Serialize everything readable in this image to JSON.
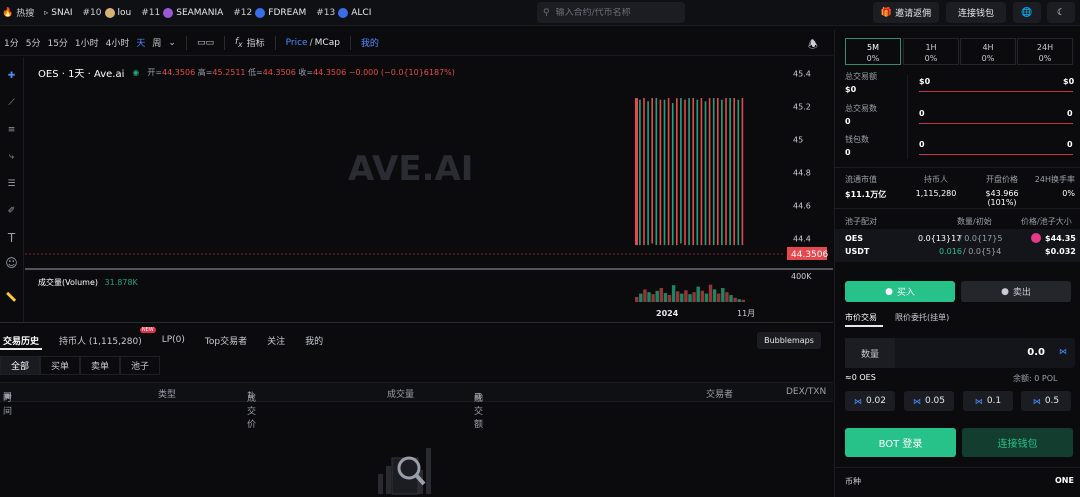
{
  "topbar": {
    "hot_label": "热搜",
    "items": [
      {
        "rank": "",
        "name": "SNAI",
        "color": "#e6e8ec"
      },
      {
        "rank": "#10",
        "name": "lou",
        "color": "#d8b273"
      },
      {
        "rank": "#11",
        "name": "SEAMANIA",
        "color": "#9b59d6"
      },
      {
        "rank": "#12",
        "name": "FDREAM",
        "color": "#3a6ee8"
      },
      {
        "rank": "#13",
        "name": "ALCI",
        "color": "#3a6ee8"
      }
    ],
    "search_placeholder": "输入合约/代币名称",
    "invite_label": "邀请返佣",
    "connect_wallet": "连接钱包",
    "icons": [
      "fire-icon",
      "search-icon",
      "gift-icon",
      "globe-icon",
      "moon-icon"
    ]
  },
  "chart_toolbar": {
    "timeframes": [
      "1分",
      "5分",
      "15分",
      "1小时",
      "4小时",
      "天",
      "周"
    ],
    "active_timeframe": "天",
    "indicator_label": "指标",
    "price_label": "Price",
    "mcap_label": "MCap",
    "mine_label": "我的"
  },
  "chart_data": {
    "type": "candlestick",
    "title": "OES · 1天 · Ave.ai",
    "ohlc_text": {
      "open_label": "开=",
      "open": "44.3506",
      "high_label": "高=",
      "high": "45.2511",
      "low_label": "低=",
      "low": "44.3506",
      "close_label": "收=",
      "close": "44.3506",
      "change": "−0.000 (−0.0{10}6187%)"
    },
    "watermark": "AVE.AI",
    "y_ticks": [
      "45.4",
      "45.2",
      "45",
      "44.8",
      "44.6",
      "44.4"
    ],
    "ylim": [
      44.3,
      45.45
    ],
    "current_price": "44.3506",
    "volume_label": "成交量(Volume)",
    "volume_value": "31.878K",
    "volume_tick": "400K",
    "x_ticks": [
      "2024",
      "11月"
    ],
    "candles": [
      {
        "o": 45.25,
        "c": 44.36,
        "dir": "down"
      },
      {
        "o": 44.36,
        "c": 45.24,
        "dir": "up"
      },
      {
        "o": 45.25,
        "c": 44.36,
        "dir": "down"
      },
      {
        "o": 44.36,
        "c": 45.23,
        "dir": "up"
      },
      {
        "o": 45.25,
        "c": 44.37,
        "dir": "down"
      },
      {
        "o": 44.36,
        "c": 45.25,
        "dir": "up"
      },
      {
        "o": 45.24,
        "c": 44.36,
        "dir": "down"
      },
      {
        "o": 44.36,
        "c": 45.24,
        "dir": "up"
      },
      {
        "o": 45.25,
        "c": 44.36,
        "dir": "down"
      },
      {
        "o": 44.36,
        "c": 45.22,
        "dir": "up"
      },
      {
        "o": 45.25,
        "c": 44.36,
        "dir": "down"
      },
      {
        "o": 44.37,
        "c": 45.25,
        "dir": "up"
      },
      {
        "o": 45.24,
        "c": 44.36,
        "dir": "down"
      },
      {
        "o": 44.36,
        "c": 45.25,
        "dir": "up"
      },
      {
        "o": 45.25,
        "c": 44.36,
        "dir": "down"
      },
      {
        "o": 44.36,
        "c": 45.24,
        "dir": "up"
      },
      {
        "o": 45.25,
        "c": 44.36,
        "dir": "down"
      },
      {
        "o": 44.36,
        "c": 45.23,
        "dir": "up"
      },
      {
        "o": 45.25,
        "c": 44.36,
        "dir": "down"
      },
      {
        "o": 44.36,
        "c": 45.25,
        "dir": "up"
      },
      {
        "o": 45.25,
        "c": 44.36,
        "dir": "down"
      },
      {
        "o": 44.36,
        "c": 45.24,
        "dir": "up"
      },
      {
        "o": 45.25,
        "c": 44.36,
        "dir": "down"
      },
      {
        "o": 44.36,
        "c": 45.25,
        "dir": "up"
      },
      {
        "o": 45.25,
        "c": 44.36,
        "dir": "down"
      },
      {
        "o": 44.36,
        "c": 45.24,
        "dir": "up"
      },
      {
        "o": 45.25,
        "c": 44.36,
        "dir": "down"
      }
    ],
    "volumes": [
      0.18,
      0.3,
      0.45,
      0.35,
      0.28,
      0.4,
      0.5,
      0.32,
      0.25,
      0.6,
      0.38,
      0.3,
      0.42,
      0.28,
      0.35,
      0.55,
      0.4,
      0.3,
      0.62,
      0.45,
      0.3,
      0.5,
      0.35,
      0.25,
      0.15,
      0.1,
      0.08
    ],
    "colors": {
      "up": "#26a27b",
      "down": "#e5484d"
    }
  },
  "bottom": {
    "tabs": [
      "交易历史",
      "持币人 (1,115,280)",
      "LP(0)",
      "Top交易者",
      "关注",
      "我的"
    ],
    "new_badge": "NEW",
    "bubblemaps": "Bubblemaps",
    "subtabs": [
      "全部",
      "买单",
      "卖单",
      "池子"
    ],
    "columns": [
      "时间",
      "类型",
      "成交价",
      "成交量",
      "成交额",
      "交易者",
      "DEX/TXN"
    ]
  },
  "panel": {
    "periods": [
      {
        "label": "5M",
        "value": "0%"
      },
      {
        "label": "1H",
        "value": "0%"
      },
      {
        "label": "4H",
        "value": "0%"
      },
      {
        "label": "24H",
        "value": "0%"
      }
    ],
    "stats": [
      {
        "label": "总交易额",
        "value": "$0",
        "left": "$0",
        "right": "$0"
      },
      {
        "label": "总交易数",
        "value": "0",
        "left": "0",
        "right": "0"
      },
      {
        "label": "钱包数",
        "value": "0",
        "left": "0",
        "right": "0"
      }
    ],
    "market": [
      {
        "label": "流通市值",
        "value": "$11.1万亿"
      },
      {
        "label": "持币人",
        "value": "1,115,280"
      },
      {
        "label": "开盘价格",
        "value": "$43.966 (101%)"
      },
      {
        "label": "24H换手率",
        "value": "0%"
      }
    ],
    "pool_header": {
      "pair": "池子配对",
      "amount": "数量/初始",
      "price": "价格/池子大小"
    },
    "pool_rows": [
      {
        "token": "OES",
        "amount": "0.0{13}17",
        "initial": "/ 0.0{17}5",
        "price": "$44.35"
      },
      {
        "token": "USDT",
        "amount": "0.016",
        "initial": "/ 0.0{5}4",
        "price": "$0.032"
      }
    ],
    "buy_label": "买入",
    "sell_label": "卖出",
    "order_tabs": [
      "市价交易",
      "限价委托(挂单)"
    ],
    "qty_label": "数量",
    "qty_value": "0.0",
    "equiv": "≈0 OES",
    "balance": "余额: 0 POL",
    "quick": [
      "0.02",
      "0.05",
      "0.1",
      "0.5"
    ],
    "bot_login": "BOT 登录",
    "connect_wallet": "连接钱包",
    "coin_label": "币种",
    "coin_value": "ONE"
  }
}
